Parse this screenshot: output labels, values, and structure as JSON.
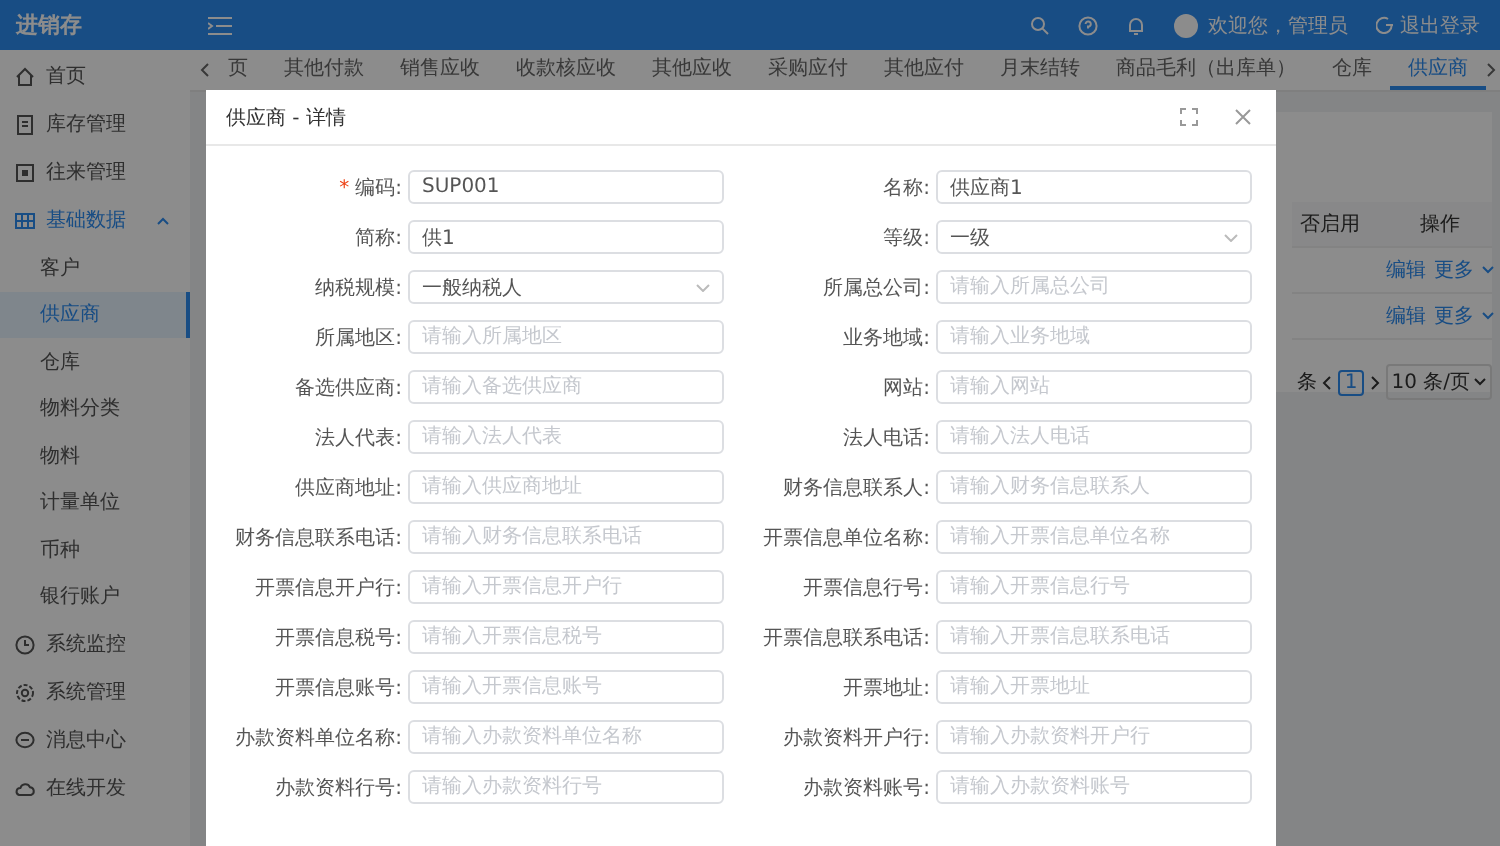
{
  "app": {
    "logo": "进销存",
    "user": "欢迎您，管理员",
    "logout": "退出登录"
  },
  "sidebar": {
    "items": [
      {
        "label": "首页",
        "expanded": false,
        "selected": false
      },
      {
        "label": "库存管理",
        "expanded": false,
        "selected": false
      },
      {
        "label": "往来管理",
        "expanded": false,
        "selected": false
      },
      {
        "label": "基础数据",
        "expanded": true,
        "selected": false,
        "children": [
          {
            "label": "客户",
            "selected": false
          },
          {
            "label": "供应商",
            "selected": true
          },
          {
            "label": "仓库",
            "selected": false
          },
          {
            "label": "物料分类",
            "selected": false
          },
          {
            "label": "物料",
            "selected": false
          },
          {
            "label": "计量单位",
            "selected": false
          },
          {
            "label": "币种",
            "selected": false
          },
          {
            "label": "银行账户",
            "selected": false
          }
        ]
      },
      {
        "label": "系统监控",
        "expanded": false,
        "selected": false
      },
      {
        "label": "系统管理",
        "expanded": false,
        "selected": false
      },
      {
        "label": "消息中心",
        "expanded": false,
        "selected": false
      },
      {
        "label": "在线开发",
        "expanded": false,
        "selected": false
      }
    ]
  },
  "tabs": [
    {
      "label": "页",
      "selected": false
    },
    {
      "label": "其他付款",
      "selected": false
    },
    {
      "label": "销售应收",
      "selected": false
    },
    {
      "label": "收款核应收",
      "selected": false
    },
    {
      "label": "其他应收",
      "selected": false
    },
    {
      "label": "采购应付",
      "selected": false
    },
    {
      "label": "其他应付",
      "selected": false
    },
    {
      "label": "月末结转",
      "selected": false
    },
    {
      "label": "商品毛利（出库单）",
      "selected": false
    },
    {
      "label": "仓库",
      "selected": false
    },
    {
      "label": "供应商",
      "selected": true
    }
  ],
  "table": {
    "columns": [
      "否启用",
      "操作"
    ],
    "rows": [
      {
        "actions": [
          "编辑",
          "更多"
        ]
      },
      {
        "actions": [
          "编辑",
          "更多"
        ]
      }
    ],
    "pagination": {
      "total_suffix": "条",
      "page": "1",
      "page_size": "10 条/页"
    }
  },
  "dialog": {
    "title": "供应商 - 详情",
    "fields": [
      {
        "label": "编码:",
        "kind": "input",
        "required_mark": "*",
        "value": "SUP001"
      },
      {
        "label": "名称:",
        "kind": "input",
        "value": "供应商1"
      },
      {
        "label": "简称:",
        "kind": "input",
        "value": "供1"
      },
      {
        "label": "等级:",
        "kind": "select",
        "value": "一级"
      },
      {
        "label": "纳税规模:",
        "kind": "select",
        "value": "一般纳税人"
      },
      {
        "label": "所属总公司:",
        "kind": "input",
        "placeholder": "请输入所属总公司"
      },
      {
        "label": "所属地区:",
        "kind": "input",
        "placeholder": "请输入所属地区"
      },
      {
        "label": "业务地域:",
        "kind": "input",
        "placeholder": "请输入业务地域"
      },
      {
        "label": "备选供应商:",
        "kind": "input",
        "placeholder": "请输入备选供应商"
      },
      {
        "label": "网站:",
        "kind": "input",
        "placeholder": "请输入网站"
      },
      {
        "label": "法人代表:",
        "kind": "input",
        "placeholder": "请输入法人代表"
      },
      {
        "label": "法人电话:",
        "kind": "input",
        "placeholder": "请输入法人电话"
      },
      {
        "label": "供应商地址:",
        "kind": "input",
        "placeholder": "请输入供应商地址"
      },
      {
        "label": "财务信息联系人:",
        "kind": "input",
        "placeholder": "请输入财务信息联系人"
      },
      {
        "label": "财务信息联系电话:",
        "kind": "input",
        "placeholder": "请输入财务信息联系电话"
      },
      {
        "label": "开票信息单位名称:",
        "kind": "input",
        "placeholder": "请输入开票信息单位名称"
      },
      {
        "label": "开票信息开户行:",
        "kind": "input",
        "placeholder": "请输入开票信息开户行"
      },
      {
        "label": "开票信息行号:",
        "kind": "input",
        "placeholder": "请输入开票信息行号"
      },
      {
        "label": "开票信息税号:",
        "kind": "input",
        "placeholder": "请输入开票信息税号"
      },
      {
        "label": "开票信息联系电话:",
        "kind": "input",
        "placeholder": "请输入开票信息联系电话"
      },
      {
        "label": "开票信息账号:",
        "kind": "input",
        "placeholder": "请输入开票信息账号"
      },
      {
        "label": "开票地址:",
        "kind": "input",
        "placeholder": "请输入开票地址"
      },
      {
        "label": "办款资料单位名称:",
        "kind": "input",
        "placeholder": "请输入办款资料单位名称"
      },
      {
        "label": "办款资料开户行:",
        "kind": "input",
        "placeholder": "请输入办款资料开户行"
      },
      {
        "label": "办款资料行号:",
        "kind": "input",
        "placeholder": "请输入办款资料行号"
      },
      {
        "label": "办款资料账号:",
        "kind": "input",
        "placeholder": "请输入办款资料账号"
      }
    ]
  }
}
